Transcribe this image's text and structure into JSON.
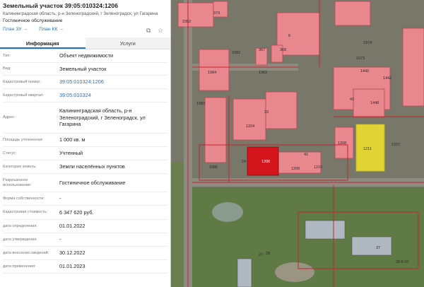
{
  "header": {
    "title": "Земельный участок 39:05:010324:1206",
    "address": "Калининградская область, р-н Зеленоградский, г Зеленоградск, ул Гагарина",
    "usage": "Гостиничное обслуживание",
    "link_plan_zu": "План ЗУ →",
    "link_plan_kk": "План КК →"
  },
  "tabs": {
    "info": "Информация",
    "services": "Услуги"
  },
  "rows": [
    {
      "label": "Тип:",
      "value": "Объект недвижимости"
    },
    {
      "label": "Вид:",
      "value": "Земельный участок"
    },
    {
      "label": "Кадастровый номер:",
      "value": "39:05:010324:1206"
    },
    {
      "label": "Кадастровый квартал:",
      "value": "39:05:010324"
    },
    {
      "label": "Адрес:",
      "value": "Калининградская область, р-н Зеленоградский, г Зеленоградск, ул Гагарина"
    },
    {
      "label": "Площадь уточненная:",
      "value": "1 000 кв. м"
    },
    {
      "label": "Статус:",
      "value": "Учтенный"
    },
    {
      "label": "Категория земель:",
      "value": "Земли населённых пунктов"
    },
    {
      "label": "Разрешенное использование:",
      "value": "Гостиничное обслуживание"
    },
    {
      "label": "Форма собственности:",
      "value": "-"
    },
    {
      "label": "Кадастровая стоимость:",
      "value": "6 347 620 руб."
    },
    {
      "label": "дата определения:",
      "value": "01.01.2022"
    },
    {
      "label": "дата утверждения:",
      "value": "-"
    },
    {
      "label": "дата внесения сведений:",
      "value": "30.12.2022"
    },
    {
      "label": "дата применения:",
      "value": "01.01.2023"
    }
  ],
  "map": {
    "labels": [
      "2352",
      "379",
      "6",
      "1982",
      "368",
      "367",
      "1962",
      "1984",
      "1983",
      "33",
      "1324",
      "43",
      "1442",
      "1448",
      "1442",
      "1208",
      "1207",
      "24",
      "41",
      "1206",
      "1211",
      "1210",
      "1209",
      "28",
      "27",
      "37",
      "39:5:10",
      "1986",
      "1974",
      "1973"
    ]
  },
  "colors": {
    "accent": "#2a6fbd",
    "parcel": "#e8888e",
    "selected": "#d4151b",
    "highlight": "#f3e32a"
  }
}
